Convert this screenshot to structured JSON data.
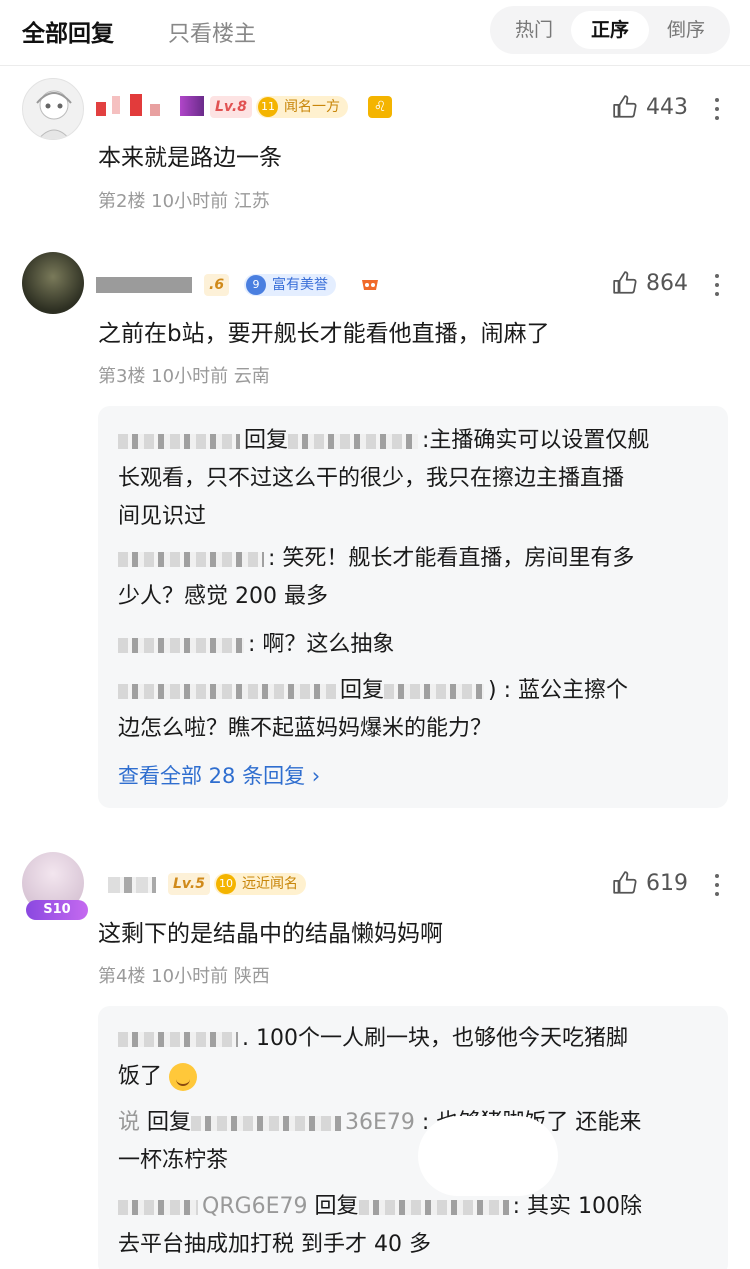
{
  "header": {
    "tab_all": "全部回复",
    "tab_op_only": "只看楼主",
    "sort": [
      "热门",
      "正序",
      "倒序"
    ],
    "sort_active": "正序"
  },
  "comments": [
    {
      "level": "Lv.8",
      "medal_num": "11",
      "medal_name": "闻名一方",
      "likes": "443",
      "text": "本来就是路边一条",
      "meta": "第2楼  10小时前  江苏"
    },
    {
      "level": ".6",
      "medal_num": "9",
      "medal_name": "富有美誉",
      "likes": "864",
      "text": "之前在b站，要开舰长才能看他直播，闹麻了",
      "meta": "第3楼  10小时前  云南",
      "replies": [
        {
          "prefix": "回复",
          "text": ":主播确实可以设置仅舰",
          "cont": "长观看，只不过这么干的很少，我只在擦边主播直播",
          "cont2": "间见识过"
        },
        {
          "text": ": 笑死！舰长才能看直播，房间里有多",
          "cont": "少人？感觉 200 最多"
        },
        {
          "text": ": 啊？这么抽象"
        },
        {
          "prefix": "回复",
          "text": ") : 蓝公主擦个",
          "cont": "边怎么啦？瞧不起蓝妈妈爆米的能力？"
        }
      ],
      "view_all": "查看全部 28 条回复 ›"
    },
    {
      "level": "Lv.5",
      "medal_num": "10",
      "medal_name": "远近闻名",
      "avatar_badge": "S10",
      "likes": "619",
      "text": "这剩下的是结晶中的结晶懒妈妈啊",
      "meta": "第4楼  10小时前  陕西",
      "replies": [
        {
          "text": ". 100个一人刷一块，也够他今天吃猪脚",
          "cont": "饭了"
        },
        {
          "lead": "说",
          "prefix": "回复",
          "tail": "36E79",
          "text": ": 也够猪脚饭了 还能来",
          "cont": "一杯冻柠茶"
        },
        {
          "lead": "QRG6E79",
          "prefix": "回复",
          "text": ": 其实 100除",
          "cont": "去平台抽成加打税 到手才 40 多"
        }
      ]
    }
  ],
  "colors": {
    "link": "#2f6ecf",
    "level8": "#f07a7a",
    "medal_gold": "#f4b400",
    "medal_blue": "#4a7fe0"
  }
}
